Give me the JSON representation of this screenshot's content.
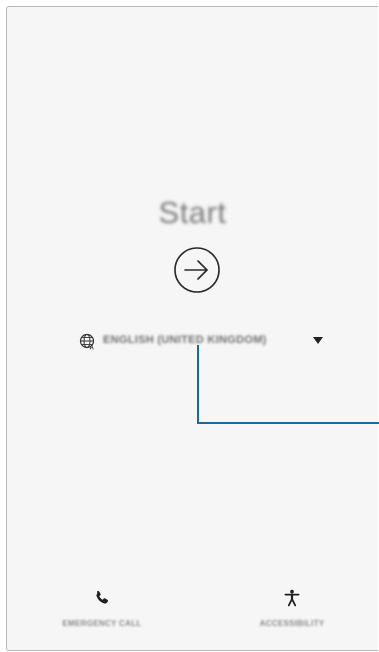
{
  "start": {
    "title": "Start"
  },
  "language": {
    "selected": "ENGLISH (UNITED KINGDOM)"
  },
  "bottom_bar": {
    "emergency_label": "EMERGENCY CALL",
    "accessibility_label": "ACCESSIBILITY"
  },
  "colors": {
    "callout": "#1a6aa0",
    "background": "#f6f6f6"
  },
  "icons": [
    "start-arrow-icon",
    "globe-icon",
    "dropdown-icon",
    "phone-icon",
    "accessibility-icon"
  ]
}
